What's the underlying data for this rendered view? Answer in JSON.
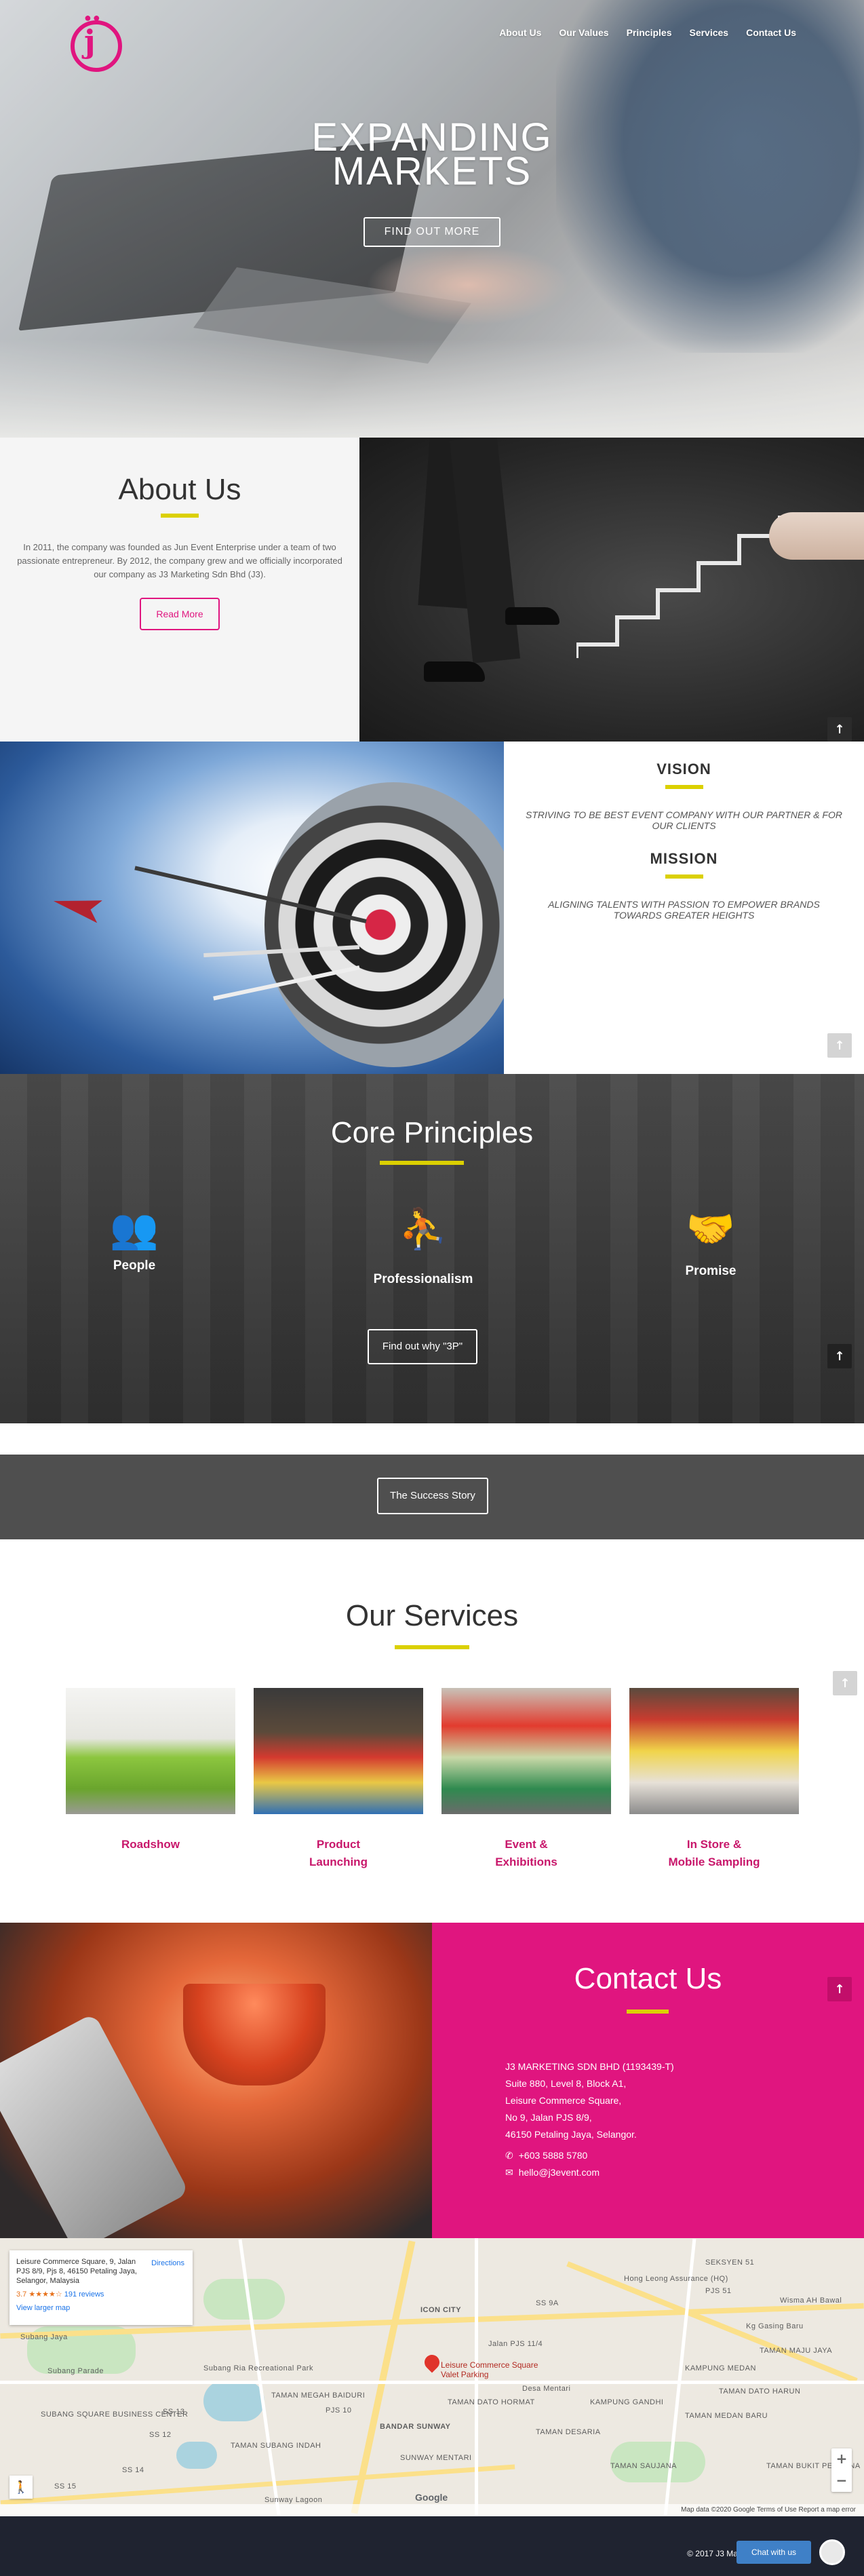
{
  "nav": {
    "items": [
      "About Us",
      "Our Values",
      "Principles",
      "Services",
      "Contact Us"
    ]
  },
  "hero": {
    "title_line1": "EXPANDING",
    "title_line2": "MARKETS",
    "cta": "FIND OUT MORE"
  },
  "about": {
    "title": "About Us",
    "text": "In 2011, the company was founded as Jun Event Enterprise under a team of two passionate entrepreneur. By 2012, the company grew and we officially incorporated our company as J3 Marketing Sdn Bhd (J3).",
    "button": "Read More"
  },
  "vision": {
    "vision_title": "VISION",
    "vision_text": "STRIVING TO BE BEST EVENT COMPANY WITH OUR PARTNER & FOR OUR CLIENTS",
    "mission_title": "MISSION",
    "mission_text": "ALIGNING TALENTS WITH PASSION TO EMPOWER BRANDS TOWARDS GREATER HEIGHTS"
  },
  "core": {
    "title": "Core Principles",
    "items": [
      {
        "label": "People",
        "icon": "people-group-icon"
      },
      {
        "label": "Professionalism",
        "icon": "team-growth-icon"
      },
      {
        "label": "Promise",
        "icon": "handshake-icon"
      }
    ],
    "button": "Find out why \"3P\""
  },
  "success": {
    "button": "The Success Story"
  },
  "services": {
    "title": "Our Services",
    "items": [
      {
        "line1": "Roadshow",
        "line2": ""
      },
      {
        "line1": "Product",
        "line2": "Launching"
      },
      {
        "line1": "Event &",
        "line2": "Exhibitions"
      },
      {
        "line1": "In Store &",
        "line2": "Mobile Sampling"
      }
    ]
  },
  "contact": {
    "title": "Contact Us",
    "company": "J3 MARKETING SDN BHD (1193439-T)",
    "address": [
      "Suite 880, Level 8, Block A1,",
      "Leisure Commerce Square,",
      "No 9, Jalan PJS 8/9,",
      "46150 Petaling Jaya, Selangor."
    ],
    "phone": "+603 5888 5780",
    "email": "hello@j3event.com"
  },
  "map": {
    "card_address": "Leisure Commerce Square, 9, Jalan PJS 8/9, Pjs 8, 46150 Petaling Jaya, Selangor, Malaysia",
    "directions": "Directions",
    "rating": "3.7",
    "stars": "★★★★☆",
    "reviews": "191 reviews",
    "larger_map": "View larger map",
    "pin_label": "Leisure Commerce Square Valet Parking",
    "labels": [
      "SEKSYEN 51",
      "Hong Leong Assurance (HQ)",
      "PJS 51",
      "Wisma AH Bawal",
      "ICON CITY",
      "SS 9A",
      "Kg Gasing Baru",
      "Subang Jaya",
      "Subang Parade",
      "Subang Ria Recreational Park",
      "TAMAN MEGAH BAIDURI",
      "PJS 10",
      "BANDAR SUNWAY",
      "SUNWAY MENTARI",
      "TAMAN DESARIA",
      "TAMAN SUBANG INDAH",
      "SUBANG SQUARE BUSINESS CENTER",
      "SS 15",
      "SS 13",
      "TAMAN DATO HARUN",
      "TAMAN MEDAN BARU",
      "TAMAN BUKIT PERDANA",
      "KAMPUNG MEDAN",
      "TAMAN MAJU JAYA",
      "KAMPUNG GANDHI",
      "TAMAN DATO HORMAT",
      "Sunway Lagoon",
      "SS 12",
      "SS 14",
      "Jalan PJS 11/4",
      "Desa Mentari",
      "TAMAN SAUJANA"
    ],
    "footer": "Map data ©2020 Google   Terms of Use   Report a map error",
    "google": "Google"
  },
  "footer": {
    "copyright": "© 2017 J3 Marketing",
    "chat": "Chat with us"
  },
  "colors": {
    "pink": "#e0157f",
    "yellow": "#dbd000",
    "dark": "#4f4f4f"
  }
}
